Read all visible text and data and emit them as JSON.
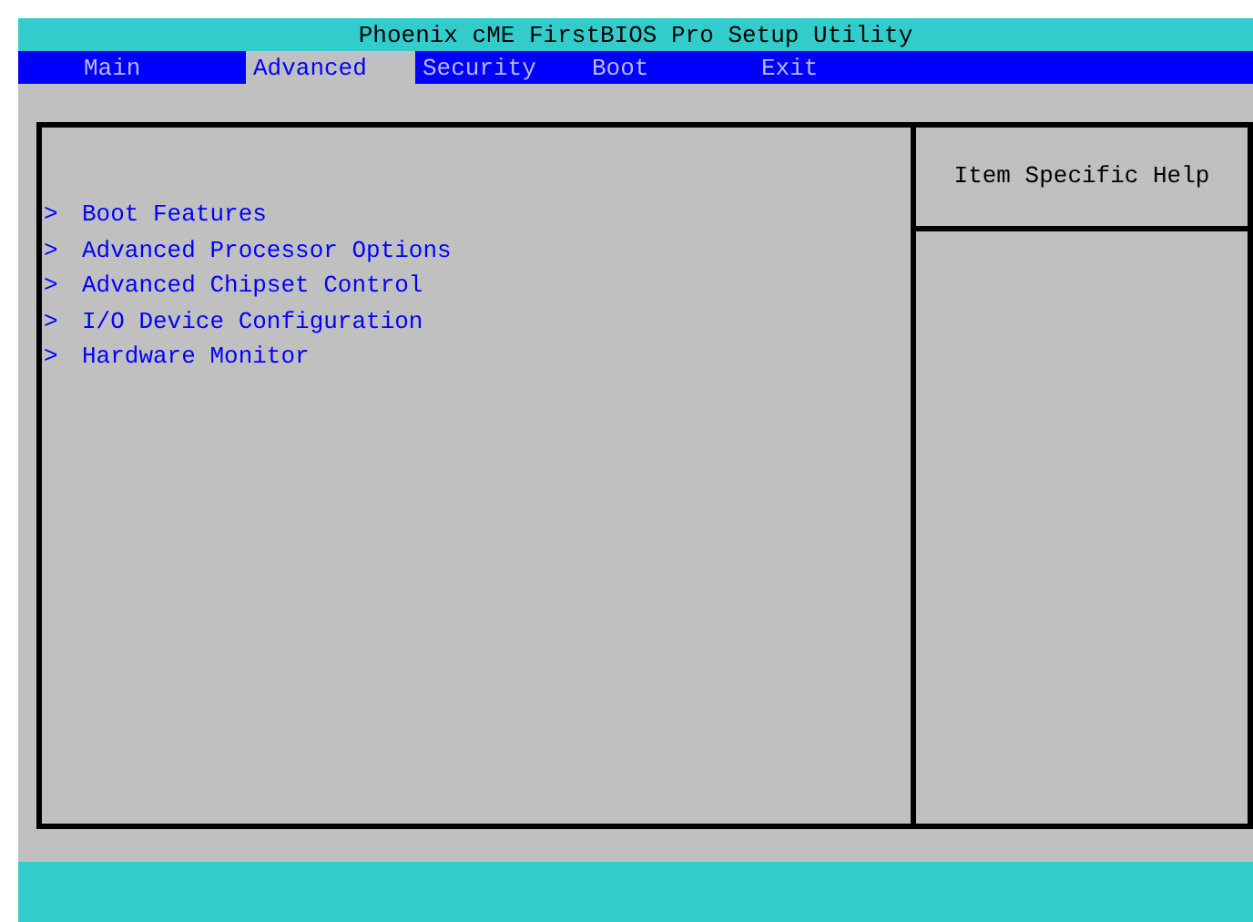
{
  "window": {
    "title": "Phoenix cME FirstBIOS Pro Setup Utility"
  },
  "tabs": [
    {
      "label": "Main",
      "selected": false
    },
    {
      "label": "Advanced",
      "selected": true
    },
    {
      "label": "Security",
      "selected": false
    },
    {
      "label": "Boot",
      "selected": false
    },
    {
      "label": "Exit",
      "selected": false
    }
  ],
  "menu_items": [
    {
      "marker": ">",
      "label": "Boot Features"
    },
    {
      "marker": ">",
      "label": "Advanced Processor Options"
    },
    {
      "marker": ">",
      "label": "Advanced Chipset Control"
    },
    {
      "marker": ">",
      "label": "I/O Device Configuration"
    },
    {
      "marker": ">",
      "label": "Hardware Monitor"
    }
  ],
  "help_panel": {
    "title": "Item Specific Help"
  }
}
